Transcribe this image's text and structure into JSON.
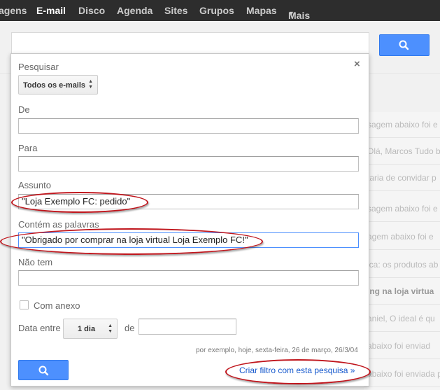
{
  "topnav": {
    "items": [
      "agens",
      "E-mail",
      "Disco",
      "Agenda",
      "Sites",
      "Grupos",
      "Mapas",
      "Mais"
    ]
  },
  "background_list": [
    {
      "text": "sagem abaixo foi e",
      "bold": false
    },
    {
      "text": "Olá, Marcos Tudo b",
      "bold": false
    },
    {
      "text": "taria de convidar p",
      "bold": false
    },
    {
      "text": "sagem abaixo foi e",
      "bold": false
    },
    {
      "text": "agem abaixo foi e",
      "bold": false
    },
    {
      "text": "ica: os produtos ab",
      "bold": false
    },
    {
      "text": "ing na loja virtua",
      "bold": true
    },
    {
      "text": "aniel, O ideal é qu",
      "bold": false
    },
    {
      "text": "abaixo foi enviad",
      "bold": false
    },
    {
      "text": "abaixo foi enviada p",
      "bold": false
    }
  ],
  "dialog": {
    "title": "Pesquisar",
    "close": "×",
    "scope_select": "Todos os e-mails",
    "labels": {
      "from": "De",
      "to": "Para",
      "subject": "Assunto",
      "has_words": "Contém as palavras",
      "doesnt_have": "Não tem",
      "has_attachment": "Com anexo",
      "date_within": "Data entre",
      "of": "de"
    },
    "values": {
      "from": "",
      "to": "",
      "subject": "\"Loja Exemplo FC: pedido\"",
      "has_words": "\"Obrigado por comprar na loja virtual Loja Exemplo FC!\"",
      "doesnt_have": "",
      "date": ""
    },
    "date_range": "1 dia",
    "date_hint": "por exemplo, hoje, sexta-feira, 26 de março, 26/3/04",
    "create_filter_link": "Criar filtro com esta pesquisa »"
  },
  "icons": {
    "search": "magnifier-icon"
  },
  "colors": {
    "accent_blue": "#4d90fe",
    "annotation_red": "#c0161d",
    "link_blue": "#1155cc"
  }
}
